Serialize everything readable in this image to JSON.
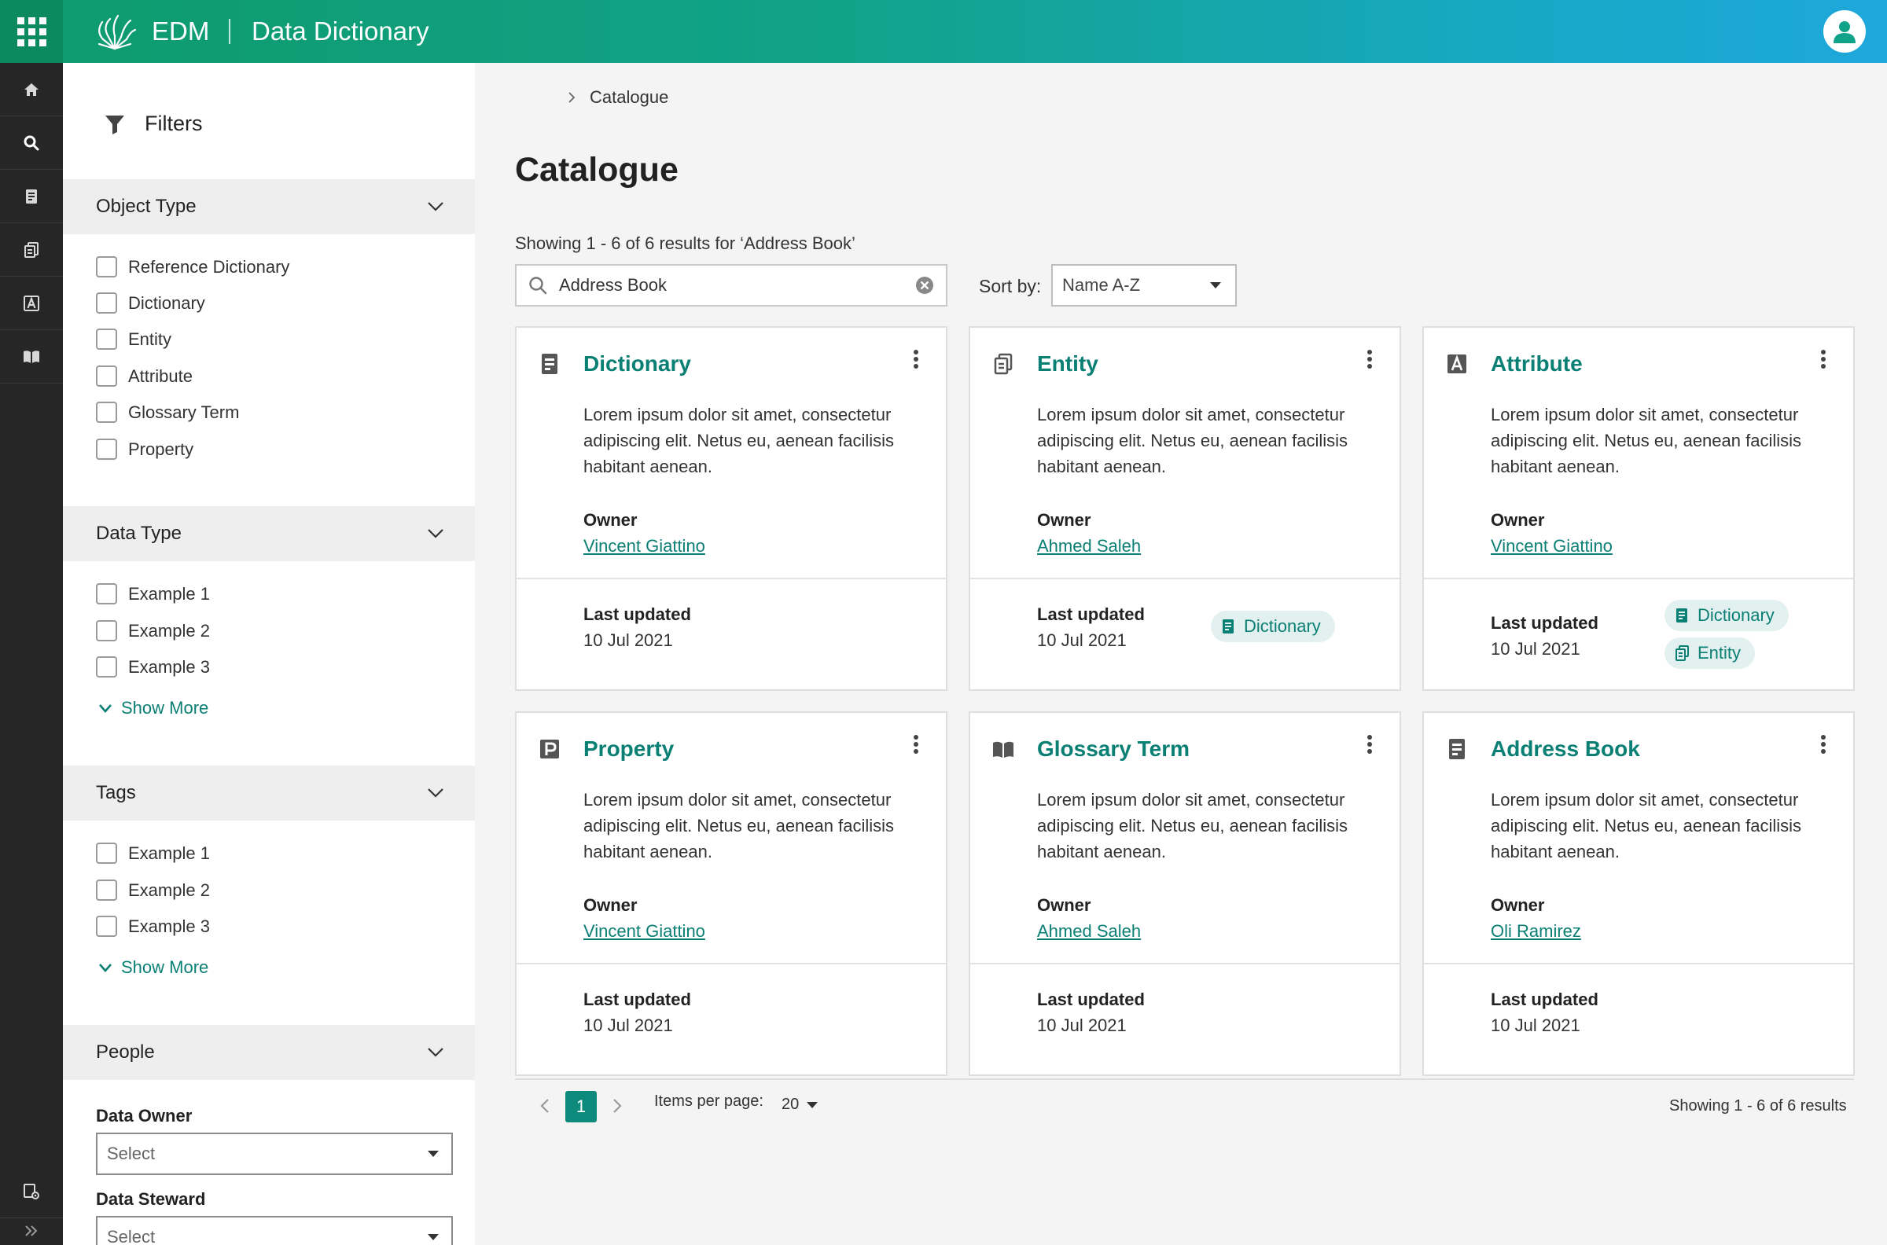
{
  "header": {
    "brand": "EDM",
    "app_title": "Data Dictionary"
  },
  "rail": {
    "items": [
      "home-icon",
      "search-icon",
      "dictionary-icon",
      "entity-icon",
      "attribute-icon",
      "glossary-icon"
    ],
    "bottom": [
      "settings-icon",
      "expand-icon"
    ]
  },
  "filters": {
    "title": "Filters",
    "object_type": {
      "title": "Object Type",
      "options": [
        "Reference Dictionary",
        "Dictionary",
        "Entity",
        "Attribute",
        "Glossary Term",
        "Property"
      ]
    },
    "data_type": {
      "title": "Data Type",
      "options": [
        "Example 1",
        "Example 2",
        "Example 3"
      ],
      "show_more": "Show More"
    },
    "tags": {
      "title": "Tags",
      "options": [
        "Example 1",
        "Example 2",
        "Example 3"
      ],
      "show_more": "Show More"
    },
    "people": {
      "title": "People",
      "data_owner_label": "Data Owner",
      "data_owner_value": "Select",
      "data_steward_label": "Data Steward",
      "data_steward_value": "Select"
    }
  },
  "main": {
    "breadcrumb": "Catalogue",
    "title": "Catalogue",
    "results_text": "Showing 1 - 6 of 6 results for ‘Address Book’",
    "search_value": "Address Book",
    "sort_label": "Sort by:",
    "sort_value": "Name A-Z",
    "owner_label": "Owner",
    "updated_label": "Last updated",
    "cards": [
      {
        "title": "Dictionary",
        "icon": "dictionary-icon",
        "desc": "Lorem ipsum dolor sit amet, consectetur adipiscing elit. Netus eu, aenean facilisis habitant aenean.",
        "owner": "Vincent Giattino",
        "date": "10 Jul 2021",
        "tags": []
      },
      {
        "title": "Entity",
        "icon": "entity-icon",
        "desc": "Lorem ipsum dolor sit amet, consectetur adipiscing elit. Netus eu, aenean facilisis habitant aenean.",
        "owner": "Ahmed Saleh",
        "date": "10 Jul 2021",
        "tags": [
          "Dictionary"
        ]
      },
      {
        "title": "Attribute",
        "icon": "attribute-icon",
        "desc": "Lorem ipsum dolor sit amet, consectetur adipiscing elit. Netus eu, aenean facilisis habitant aenean.",
        "owner": "Vincent Giattino",
        "date": "10 Jul 2021",
        "tags": [
          "Dictionary",
          "Entity"
        ]
      },
      {
        "title": "Property",
        "icon": "property-icon",
        "desc": "Lorem ipsum dolor sit amet, consectetur adipiscing elit. Netus eu, aenean facilisis habitant aenean.",
        "owner": "Vincent Giattino",
        "date": "10 Jul 2021",
        "tags": []
      },
      {
        "title": "Glossary Term",
        "icon": "glossary-icon",
        "desc": "Lorem ipsum dolor sit amet, consectetur adipiscing elit. Netus eu, aenean facilisis habitant aenean.",
        "owner": "Ahmed Saleh",
        "date": "10 Jul 2021",
        "tags": []
      },
      {
        "title": "Address Book",
        "icon": "dictionary-icon",
        "desc": "Lorem ipsum dolor sit amet, consectetur adipiscing elit. Netus eu, aenean facilisis habitant aenean.",
        "owner": "Oli Ramirez",
        "date": "10 Jul 2021",
        "tags": []
      }
    ]
  },
  "pagination": {
    "current_page": "1",
    "items_per_page_label": "Items per page:",
    "items_per_page": "20",
    "total_text": "Showing 1 - 6 of 6 results"
  },
  "colors": {
    "accent": "#0a7f74",
    "rail": "#262626",
    "header_start": "#0e9a6c",
    "header_end": "#1ea8dc"
  }
}
